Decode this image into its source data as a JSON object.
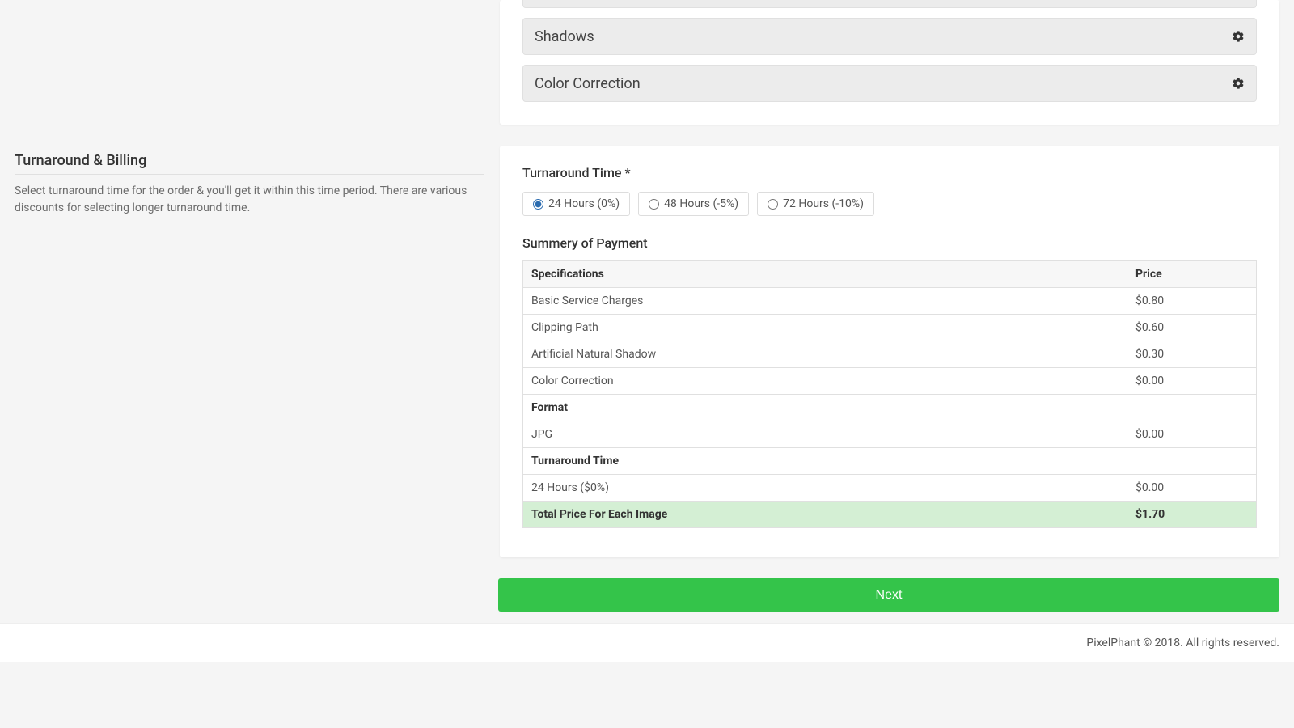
{
  "accordions": {
    "shadows": "Shadows",
    "color_correction": "Color Correction"
  },
  "left": {
    "title": "Turnaround & Billing",
    "desc": "Select turnaround time for the order & you'll get it within this time period. There are various discounts for selecting longer turnaround time."
  },
  "turnaround": {
    "label": "Turnaround Time *",
    "options": [
      {
        "label": "24 Hours (0%)",
        "selected": true
      },
      {
        "label": "48 Hours (-5%)",
        "selected": false
      },
      {
        "label": "72 Hours (-10%)",
        "selected": false
      }
    ]
  },
  "summary": {
    "title": "Summery of Payment",
    "head_spec": "Specifications",
    "head_price": "Price",
    "rows": [
      {
        "spec": "Basic Service Charges",
        "price": "$0.80"
      },
      {
        "spec": "Clipping Path",
        "price": "$0.60"
      },
      {
        "spec": "Artificial Natural Shadow",
        "price": "$0.30"
      },
      {
        "spec": "Color Correction",
        "price": "$0.00"
      }
    ],
    "format_label": "Format",
    "format_spec": "JPG",
    "format_price": "$0.00",
    "turnaround_label": "Turnaround Time",
    "turnaround_spec": "24 Hours ($0%)",
    "turnaround_price": "$0.00",
    "total_label": "Total Price For Each Image",
    "total_price": "$1.70"
  },
  "next_label": "Next",
  "footer": "PixelPhant © 2018. All rights reserved."
}
